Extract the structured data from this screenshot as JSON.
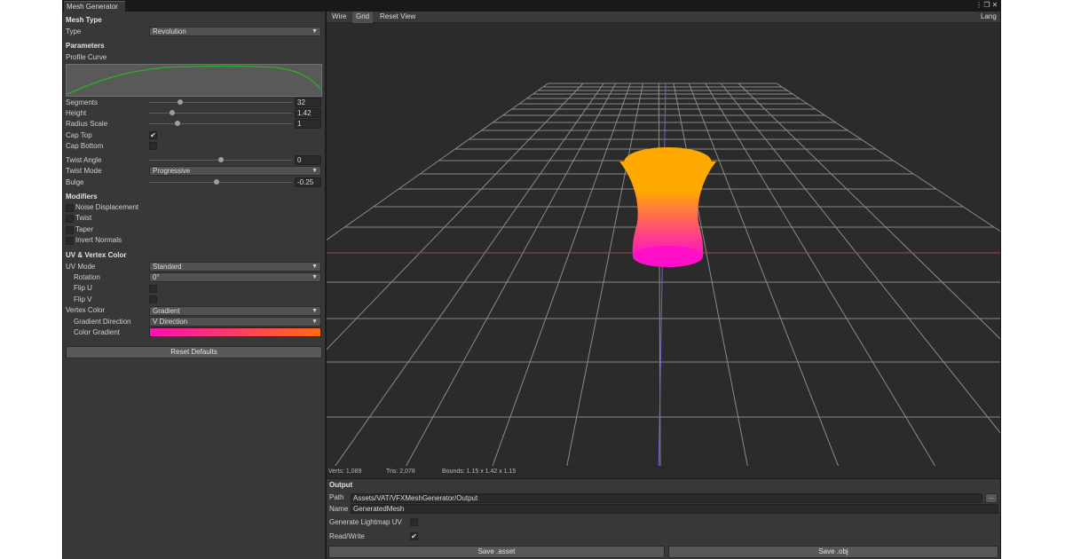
{
  "window": {
    "tab_label": "Mesh Generator",
    "menu_icon": "more-icon",
    "maximize_icon": "maximize-icon",
    "close_icon": "close-icon"
  },
  "left": {
    "mesh_type_header": "Mesh Type",
    "type_label": "Type",
    "type_value": "Revolution",
    "parameters_header": "Parameters",
    "profile_curve_label": "Profile Curve",
    "profile_curve_color": "#28b428",
    "segments_label": "Segments",
    "segments_value": "32",
    "segments_fraction": 0.22,
    "height_label": "Height",
    "height_value": "1.42",
    "height_fraction": 0.16,
    "radius_label": "Radius Scale",
    "radius_value": "1",
    "radius_fraction": 0.2,
    "cap_top_label": "Cap Top",
    "cap_top_checked": "✔",
    "cap_bottom_label": "Cap Bottom",
    "cap_bottom_checked": "",
    "twist_angle_label": "Twist Angle",
    "twist_angle_value": "0",
    "twist_angle_fraction": 0.5,
    "twist_mode_label": "Twist Mode",
    "twist_mode_value": "Progressive",
    "bulge_label": "Bulge",
    "bulge_value": "-0.25",
    "bulge_fraction": 0.475,
    "modifiers_header": "Modifiers",
    "noise_label": "Noise Displacement",
    "twist_label": "Twist",
    "taper_label": "Taper",
    "invert_normals_label": "Invert Normals",
    "uv_header": "UV & Vertex Color",
    "uv_mode_label": "UV Mode",
    "uv_mode_value": "Standard",
    "rotation_label": "Rotation",
    "rotation_value": "0°",
    "flip_u_label": "Flip U",
    "flip_v_label": "Flip V",
    "vertex_color_label": "Vertex Color",
    "vertex_color_value": "Gradient",
    "gradient_direction_label": "Gradient Direction",
    "gradient_direction_value": "V Direction",
    "color_gradient_label": "Color Gradient",
    "gradient_start": "#ff10b0",
    "gradient_end": "#ff6a18",
    "reset_button": "Reset Defaults"
  },
  "viewport": {
    "wire_button": "Wire",
    "grid_button": "Grid",
    "reset_view_button": "Reset View",
    "lang_button": "Lang",
    "mesh_top_color": "#ffaa00",
    "mesh_bottom_color": "#ff10c8",
    "x_axis_color": "#a04848",
    "z_axis_color": "#6868c8"
  },
  "stats": {
    "verts": "Verts: 1,089",
    "tris": "Tris: 2,078",
    "bounds": "Bounds: 1.15 x 1.42 x 1.15"
  },
  "output": {
    "header": "Output",
    "path_label": "Path",
    "path_value": "Assets/VAT/VFXMeshGenerator/Output",
    "browse_button": "...",
    "name_label": "Name",
    "name_value": "GeneratedMesh",
    "lightmap_label": "Generate Lightmap UV",
    "lightmap_checked": "",
    "readwrite_label": "Read/Write",
    "readwrite_checked": "✔",
    "save_asset_button": "Save .asset",
    "save_obj_button": "Save .obj"
  }
}
